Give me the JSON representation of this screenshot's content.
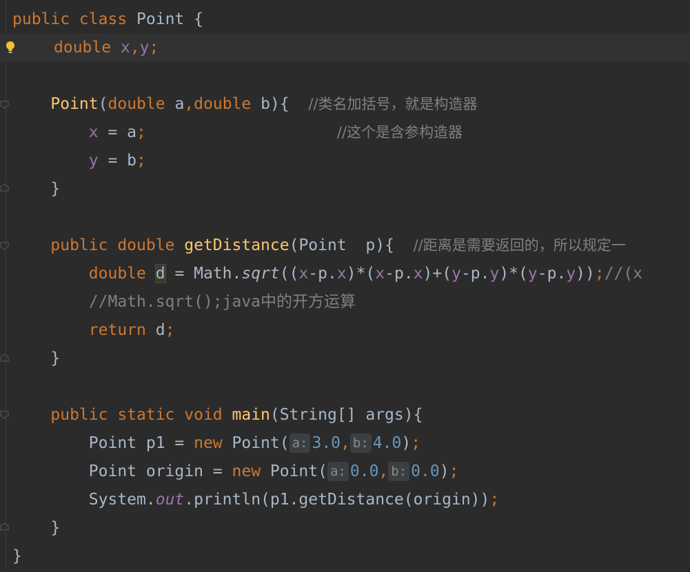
{
  "code": {
    "l1": {
      "kw": "public class",
      "name": "Point",
      "brace": "{"
    },
    "l2": {
      "type": "double",
      "fx": "x",
      "comma": ",",
      "fy": "y",
      "semi": ";"
    },
    "l4": {
      "ctor": "Point",
      "open": "(",
      "t1": "double",
      "p1": "a",
      "comma": ",",
      "t2": "double",
      "p2": "b",
      "close": "){",
      "comment": "//类名加括号，就是构造器"
    },
    "l5": {
      "fx": "x",
      "assign": " = a",
      "semi": ";",
      "comment": "//这个是含参构造器"
    },
    "l6": {
      "fy": "y",
      "assign": " = b",
      "semi": ";"
    },
    "l7": {
      "brace": "}"
    },
    "l9": {
      "kw": "public double",
      "fn": "getDistance",
      "params": "(Point  p){",
      "comment": "//距离是需要返回的，所以规定一"
    },
    "l10": {
      "type": "double",
      "var": "d",
      "eq": " = Math.",
      "call": "sqrt",
      "segs": [
        {
          "t": "((",
          "c": ""
        },
        {
          "t": "x",
          "c": "fld"
        },
        {
          "t": "-p.",
          "c": ""
        },
        {
          "t": "x",
          "c": "fld"
        },
        {
          "t": ")*(",
          "c": ""
        },
        {
          "t": "x",
          "c": "fld"
        },
        {
          "t": "-p.",
          "c": ""
        },
        {
          "t": "x",
          "c": "fld"
        },
        {
          "t": ")+(",
          "c": ""
        },
        {
          "t": "y",
          "c": "fld"
        },
        {
          "t": "-p.",
          "c": ""
        },
        {
          "t": "y",
          "c": "fld"
        },
        {
          "t": ")*(",
          "c": ""
        },
        {
          "t": "y",
          "c": "fld"
        },
        {
          "t": "-p.",
          "c": ""
        },
        {
          "t": "y",
          "c": "fld"
        },
        {
          "t": "))",
          "c": ""
        },
        {
          "t": ";",
          "c": "kw"
        },
        {
          "t": "//(x",
          "c": "cmt"
        }
      ]
    },
    "l11": {
      "comment": "//Math.sqrt();java中的开方运算"
    },
    "l12": {
      "kw": "return",
      "rest": " d",
      "semi": ";"
    },
    "l13": {
      "brace": "}"
    },
    "l15": {
      "kw": "public static void",
      "fn": "main",
      "params": "(String[] args){"
    },
    "l16": {
      "pre": "Point p1 = ",
      "kw": "new",
      "ctor": " Point(",
      "h1": "a:",
      "v1": "3.0",
      "comma": ",",
      "h2": "b:",
      "v2": "4.0",
      "close": ")",
      "semi": ";"
    },
    "l17": {
      "pre": "Point origin = ",
      "kw": "new",
      "ctor": " Point(",
      "h1": "a:",
      "v1": "0.0",
      "comma": ",",
      "h2": "b:",
      "v2": "0.0",
      "close": ")",
      "semi": ";"
    },
    "l18": {
      "pre": "System.",
      "field": "out",
      "rest": ".println(p1.getDistance(origin))",
      "semi": ";"
    },
    "l19": {
      "brace": "}"
    },
    "l20": {
      "brace": "}"
    }
  },
  "colors": {
    "background": "#2b2b2b",
    "keyword": "#cc7832",
    "field": "#9876aa",
    "method": "#ffc66d",
    "number": "#6897bb",
    "comment": "#808080",
    "text": "#a9b7c6"
  },
  "icons": [
    "intention-bulb-icon",
    "fold-marker-icon"
  ]
}
